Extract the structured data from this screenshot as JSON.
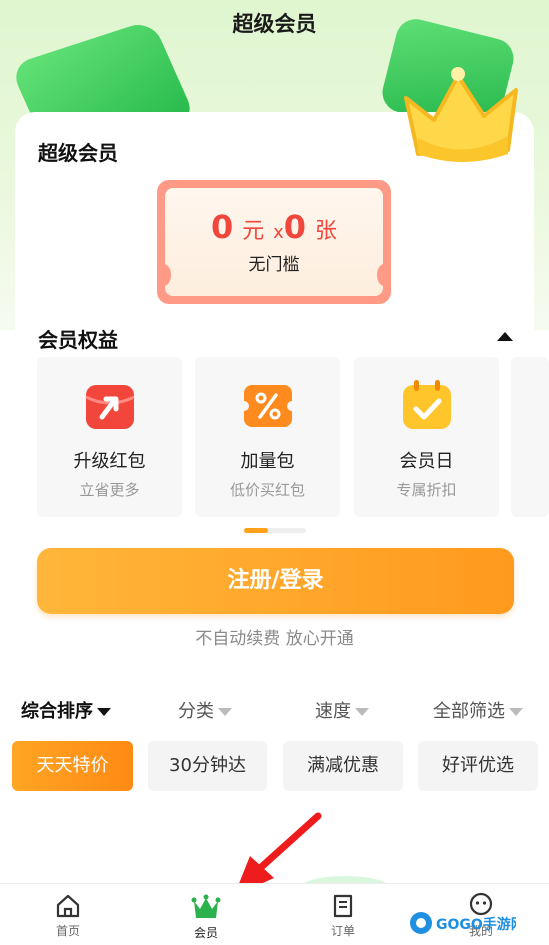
{
  "header": {
    "title": "超级会员"
  },
  "card": {
    "title": "超级会员",
    "coupon": {
      "amount": "0",
      "unit": "元",
      "times": "x",
      "count": "0",
      "count_unit": "张",
      "threshold": "无门槛"
    }
  },
  "benefits": {
    "title": "会员权益",
    "items": [
      {
        "name": "升级红包",
        "desc": "立省更多",
        "icon": "upgrade-redpacket-icon"
      },
      {
        "name": "加量包",
        "desc": "低价买红包",
        "icon": "discount-coupon-icon"
      },
      {
        "name": "会员日",
        "desc": "专属折扣",
        "icon": "calendar-check-icon"
      }
    ],
    "pager": {
      "page": 1
    }
  },
  "login": {
    "button": "注册/登录",
    "note": "不自动续费 放心开通"
  },
  "sort": {
    "items": [
      {
        "label": "综合排序",
        "active": true
      },
      {
        "label": "分类",
        "active": false
      },
      {
        "label": "速度",
        "active": false
      },
      {
        "label": "全部筛选",
        "active": false
      }
    ]
  },
  "chips": [
    {
      "label": "天天特价",
      "active": true
    },
    {
      "label": "30分钟达",
      "active": false
    },
    {
      "label": "满减优惠",
      "active": false
    },
    {
      "label": "好评优选",
      "active": false
    }
  ],
  "tabbar": {
    "items": [
      {
        "label": "首页",
        "icon": "home-icon"
      },
      {
        "label": "会员",
        "icon": "crown-icon",
        "active": true
      },
      {
        "label": "订单",
        "icon": "receipt-icon"
      },
      {
        "label": "我的",
        "icon": "profile-icon"
      }
    ]
  },
  "watermark": {
    "text": "GOGO手游网"
  },
  "colors": {
    "accent": "#ffa21a",
    "coupon_red": "#f0463c",
    "brand_green": "#25b84a"
  }
}
